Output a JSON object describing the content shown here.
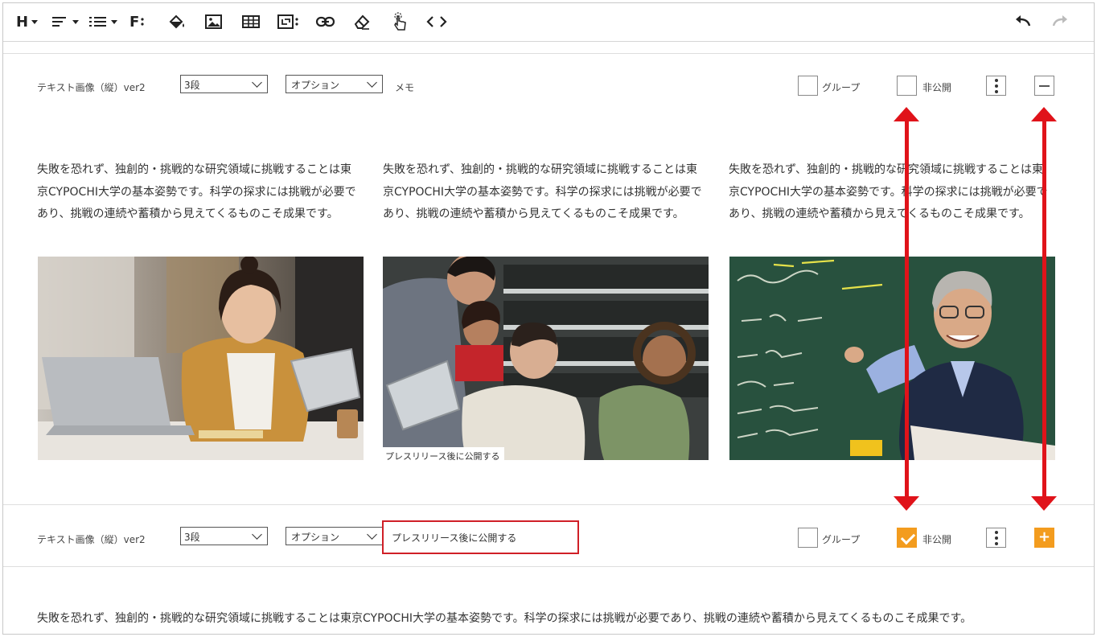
{
  "toolbar": {
    "heading_label": "H",
    "font_label": "F",
    "tools": [
      "heading-tool",
      "align-tool",
      "list-tool",
      "font-tool",
      "fill-color-tool",
      "image-tool",
      "table-tool",
      "file-tool",
      "link-tool",
      "eraser-tool",
      "touch-tool",
      "code-tool",
      "undo-tool",
      "redo-tool"
    ]
  },
  "block1": {
    "name": "テキスト画像（縦）ver2",
    "columns_select": "3段",
    "option_select": "オプション",
    "memo_label": "メモ",
    "group_label": "グループ",
    "group_checked": false,
    "private_label": "非公開",
    "private_checked": false
  },
  "columns": [
    {
      "text": "失敗を恐れず、独創的・挑戦的な研究領域に挑戦することは東京CYPOCHI大学の基本姿勢です。科学の探求には挑戦が必要であり、挑戦の連続や蓄積から見えてくるものこそ成果です。",
      "image": "student-with-laptop-and-tablet"
    },
    {
      "text": "失敗を恐れず、独創的・挑戦的な研究領域に挑戦することは東京CYPOCHI大学の基本姿勢です。科学の探求には挑戦が必要であり、挑戦の連続や蓄積から見えてくるものこそ成果です。",
      "image": "students-in-lecture-hall",
      "caption": "プレスリリース後に公開する"
    },
    {
      "text": "失敗を恐れず、独創的・挑戦的な研究領域に挑戦することは東京CYPOCHI大学の基本姿勢です。科学の探求には挑戦が必要であり、挑戦の連続や蓄積から見えてくるものこそ成果です。",
      "image": "professor-at-chalkboard"
    }
  ],
  "block2": {
    "name": "テキスト画像（縦）ver2",
    "columns_select": "3段",
    "option_select": "オプション",
    "memo_value": "プレスリリース後に公開する",
    "group_label": "グループ",
    "group_checked": false,
    "private_label": "非公開",
    "private_checked": true,
    "body_text": "失敗を恐れず、独創的・挑戦的な研究領域に挑戦することは東京CYPOCHI大学の基本姿勢です。科学の探求には挑戦が必要であり、挑戦の連続や蓄積から見えてくるものこそ成果です。"
  },
  "colors": {
    "accent_orange": "#f39c1e",
    "annotation_red": "#e0131a"
  }
}
